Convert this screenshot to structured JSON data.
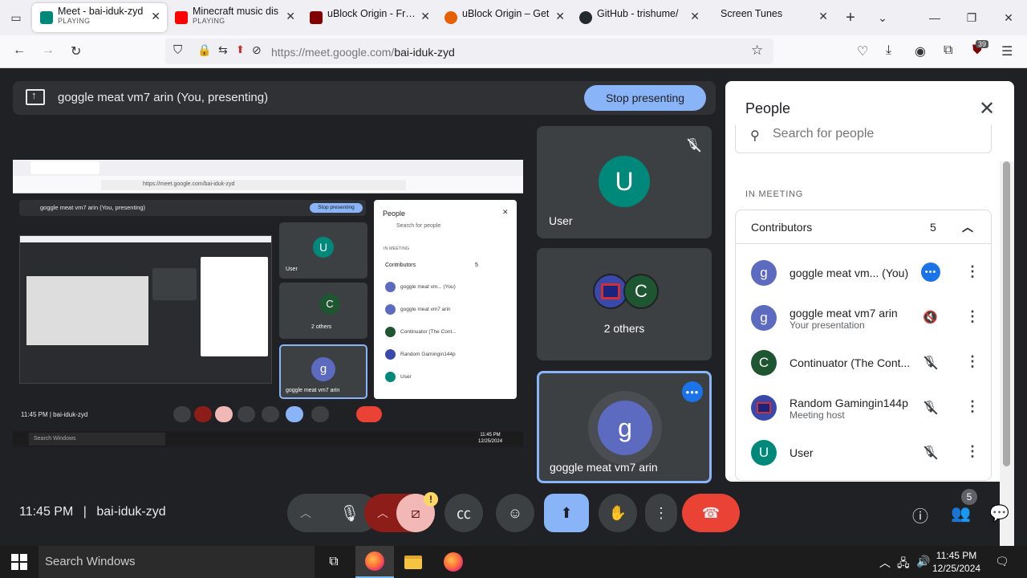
{
  "browser": {
    "tabs": [
      {
        "title": "Meet - bai-iduk-zyd",
        "sub": "PLAYING",
        "color": "#00897b"
      },
      {
        "title": "Minecraft music dis",
        "sub": "PLAYING",
        "color": "#ff0000"
      },
      {
        "title": "uBlock Origin - Free",
        "sub": "",
        "color": "#800000"
      },
      {
        "title": "uBlock Origin – Get",
        "sub": "",
        "color": "#e66000"
      },
      {
        "title": "GitHub - trishume/",
        "sub": "",
        "color": "#24292e"
      },
      {
        "title": "Screen Tunes",
        "sub": "",
        "color": ""
      }
    ],
    "url_host": "https://meet.google.com/",
    "url_path": "bai-iduk-zyd",
    "extension_badge": "39"
  },
  "meet": {
    "presenting_text": "goggle meat vm7 arin (You, presenting)",
    "stop_presenting": "Stop presenting",
    "tiles": {
      "user_initial": "U",
      "user_name": "User",
      "others_initial": "C",
      "others_label": "2 others",
      "me_initial": "g",
      "me_name": "goggle meat vm7 arin"
    },
    "clock": "11:45 PM",
    "separator": "|",
    "meeting_code": "bai-iduk-zyd",
    "people_badge": "5",
    "warning": "!"
  },
  "shared_screen": {
    "url": "https://meet.google.com/bai-iduk-zyd",
    "present_text": "goggle meat vm7 arin (You, presenting)",
    "stop": "Stop presenting",
    "people_title": "People",
    "search": "Search for people",
    "section": "IN MEETING",
    "group": "Contributors",
    "group_count": "5",
    "rows": [
      "goggle meat vm... (You)",
      "goggle meat vm7 arin",
      "Continuator (The Cont...",
      "Random Gamingin144p",
      "User"
    ],
    "tile_user": "User",
    "tile_others": "2 others",
    "tile_me": "goggle meat vm7 arin",
    "clock": "11:45 PM  |  bai-iduk-zyd",
    "taskbar_search": "Search Windows",
    "taskbar_time": "11:45 PM",
    "taskbar_date": "12/25/2024"
  },
  "people_panel": {
    "title": "People",
    "search_placeholder": "Search for people",
    "section": "IN MEETING",
    "group_label": "Contributors",
    "group_count": "5",
    "participants": [
      {
        "initial": "g",
        "name": "goggle meat vm...",
        "suffix": "(You)",
        "sub": "",
        "color": "#5c6bc0"
      },
      {
        "initial": "g",
        "name": "goggle meat vm7 arin",
        "suffix": "",
        "sub": "Your presentation",
        "color": "#5c6bc0"
      },
      {
        "initial": "C",
        "name": "Continuator (The Cont...",
        "suffix": "",
        "sub": "",
        "color": "#1e5631"
      },
      {
        "initial": "",
        "name": "Random Gamingin144p",
        "suffix": "",
        "sub": "Meeting host",
        "color": "#3949ab"
      },
      {
        "initial": "U",
        "name": "User",
        "suffix": "",
        "sub": "",
        "color": "#00897b"
      }
    ]
  },
  "taskbar": {
    "search": "Search Windows",
    "time": "11:45 PM",
    "date": "12/25/2024"
  },
  "colors": {
    "meet_bg": "#202124",
    "tile_bg": "#3c4043",
    "accent_blue": "#8ab4f8",
    "end_call_red": "#ea4335"
  }
}
